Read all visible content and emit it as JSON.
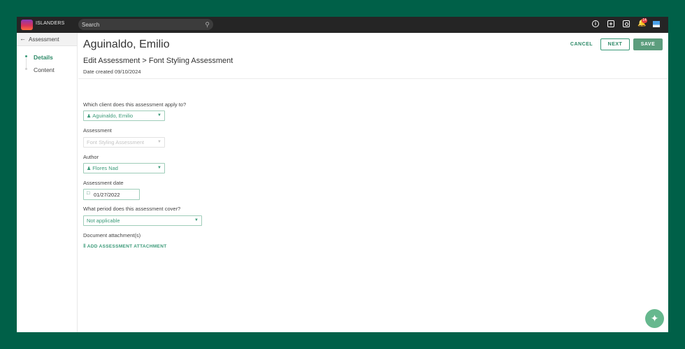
{
  "topbar": {
    "brand": "ISLANDERS",
    "search_placeholder": "Search",
    "notification_count": "14",
    "icons": [
      "info-icon",
      "add-icon",
      "settings-icon",
      "bell-icon",
      "flag-icon",
      "search-icon"
    ]
  },
  "sidebar": {
    "back_label": "Assessment",
    "steps": [
      {
        "label": "Details",
        "active": true
      },
      {
        "label": "Content",
        "active": false
      }
    ]
  },
  "header": {
    "client_name": "Aguinaldo, Emilio",
    "breadcrumb": "Edit Assessment > Font Styling Assessment",
    "date_created": "Date created 09/10/2024",
    "cancel_label": "CANCEL",
    "next_label": "NEXT",
    "save_label": "SAVE"
  },
  "form": {
    "client_label": "Which client does this assessment apply to?",
    "client_value": "Aguinaldo, Emilio",
    "assessment_label": "Assessment",
    "assessment_value": "Font Styling Assessment",
    "author_label": "Author",
    "author_value": "Flores Nad",
    "date_label": "Assessment date",
    "date_value": "01/27/2022",
    "period_label": "What period does this assessment cover?",
    "period_value": "Not applicable",
    "attachments_label": "Document attachment(s)",
    "add_attachment_label": "ADD ASSESSMENT ATTACHMENT"
  },
  "colors": {
    "frame": "#006048",
    "accent": "#3a9a78",
    "save_button": "#5c9d7d",
    "topbar": "#252525"
  }
}
